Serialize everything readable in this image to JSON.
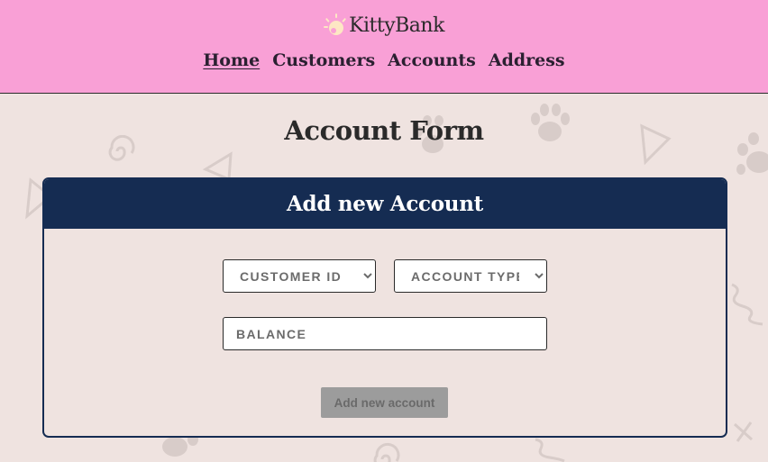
{
  "brand": {
    "name": "KittyBank",
    "icon": "paw-sun-icon"
  },
  "nav": {
    "items": [
      {
        "label": "Home",
        "active": true
      },
      {
        "label": "Customers",
        "active": false
      },
      {
        "label": "Accounts",
        "active": false
      },
      {
        "label": "Address",
        "active": false
      }
    ]
  },
  "page": {
    "title": "Account Form"
  },
  "form": {
    "header": "Add new Account",
    "customer_id": {
      "selected": "CUSTOMER ID"
    },
    "account_type": {
      "selected": "ACCOUNT TYPE"
    },
    "balance": {
      "placeholder": "BALANCE",
      "value": ""
    },
    "submit_label": "Add new account"
  },
  "colors": {
    "header_bg": "#f9a0d6",
    "page_bg": "#efe3e0",
    "card_accent": "#152c52",
    "decoration": "#d8ccc9",
    "button_disabled": "#9c9c9c"
  }
}
